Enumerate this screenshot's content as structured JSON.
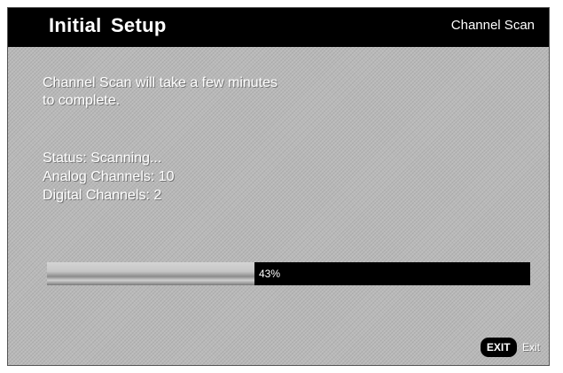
{
  "header": {
    "title": "Initial  Setup",
    "section": "Channel Scan"
  },
  "message": {
    "line1": "Channel Scan will take a few minutes",
    "line2": "to complete."
  },
  "scan": {
    "status": "Status: Scanning...",
    "analog": "Analog Channels: 10",
    "digital": "Digital Channels: 2"
  },
  "progress": {
    "percent": 43,
    "label": "43%"
  },
  "footer": {
    "exit_key": "EXIT",
    "exit_label": "Exit"
  },
  "colors": {
    "header_bg": "#000000",
    "screen_bg": "#b9b9b9",
    "text": "#ffffff",
    "progress_track": "#000000"
  }
}
